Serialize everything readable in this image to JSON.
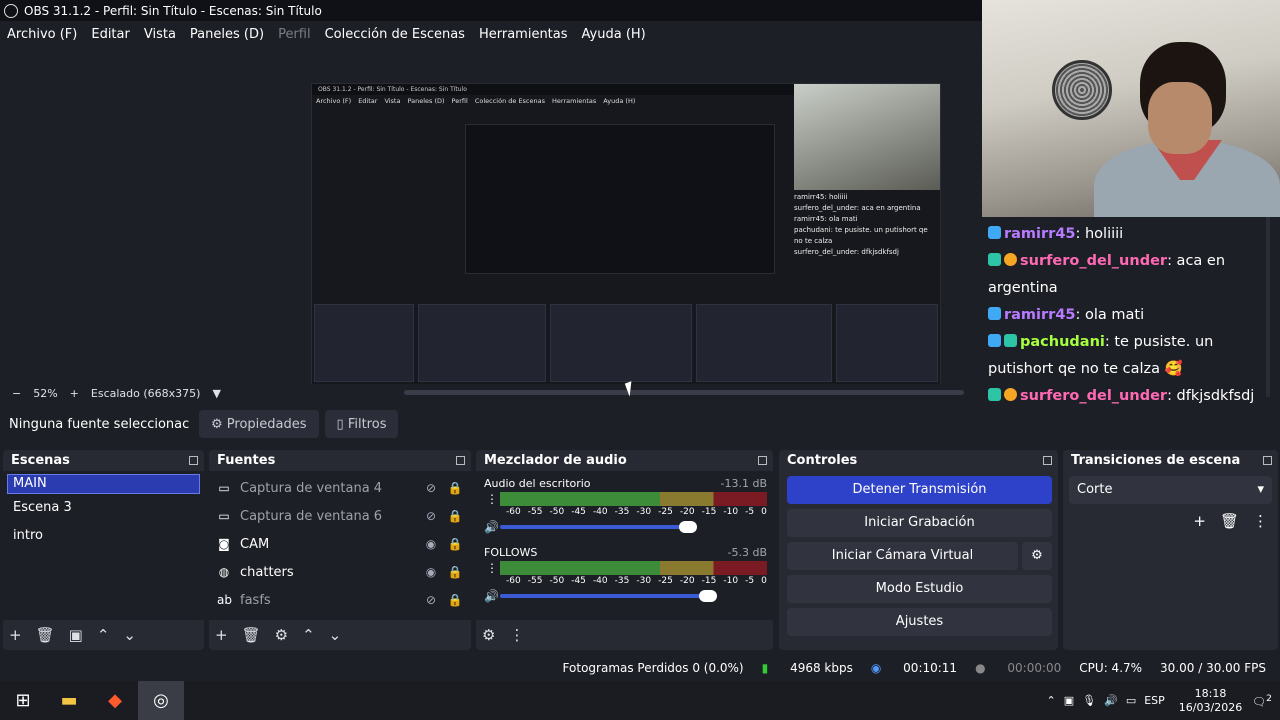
{
  "window": {
    "title": "OBS 31.1.2 - Perfil: Sin Título - Escenas: Sin Título"
  },
  "menu": [
    {
      "label": "Archivo (F)",
      "disabled": false
    },
    {
      "label": "Editar",
      "disabled": false
    },
    {
      "label": "Vista",
      "disabled": false
    },
    {
      "label": "Paneles (D)",
      "disabled": false
    },
    {
      "label": "Perfil",
      "disabled": true
    },
    {
      "label": "Colección de Escenas",
      "disabled": false
    },
    {
      "label": "Herramientas",
      "disabled": false
    },
    {
      "label": "Ayuda (H)",
      "disabled": false
    }
  ],
  "nested_preview": {
    "title": "OBS 31.1.2 - Perfil: Sin Título - Escenas: Sin Título",
    "menu": [
      "Archivo (F)",
      "Editar",
      "Vista",
      "Paneles (D)",
      "Perfil",
      "Colección de Escenas",
      "Herramientas",
      "Ayuda (H)"
    ],
    "chat": [
      "ramirr45: holiiii",
      "surfero_del_under: aca en argentina",
      "ramirr45: ola mati",
      "pachudani: te pusiste. un putishort qe no te calza",
      "surfero_del_under: dfkjsdkfsdj"
    ]
  },
  "chat": {
    "messages": [
      {
        "user": "ramirr45",
        "text": ": holiiii",
        "color": "#b77bff"
      },
      {
        "user": "surfero_del_under",
        "text": ": aca en argentina",
        "color": "#ff69b4"
      },
      {
        "user": "ramirr45",
        "text": ": ola mati",
        "color": "#b77bff"
      },
      {
        "user": "pachudani",
        "text": ": te pusiste. un putishort qe no te calza 🥰",
        "color": "#a6ff3f"
      },
      {
        "user": "surfero_del_under",
        "text": ": dfkjsdkfsdj",
        "color": "#ff69b4"
      }
    ]
  },
  "scale": {
    "minus": "−",
    "zoom": "52%",
    "plus": "+",
    "label": "Escalado (668x375)"
  },
  "propbar": {
    "no_source": "Ninguna fuente seleccionac",
    "properties": "Propiedades",
    "filters": "Filtros"
  },
  "scenes": {
    "title": "Escenas",
    "items": [
      "MAIN",
      "Escena 3",
      "intro"
    ],
    "selected": 0
  },
  "sources": {
    "title": "Fuentes",
    "items": [
      {
        "name": "Captura de ventana 4",
        "icon": "window-icon",
        "visible": false
      },
      {
        "name": "Captura de ventana 6",
        "icon": "window-icon",
        "visible": false
      },
      {
        "name": "CAM",
        "icon": "camera-icon",
        "visible": true
      },
      {
        "name": "chatters",
        "icon": "browser-icon",
        "visible": true
      },
      {
        "name": "fasfs",
        "icon": "text-icon",
        "visible": false
      }
    ]
  },
  "mixer": {
    "title": "Mezclador de audio",
    "channels": [
      {
        "name": "Audio del escritorio",
        "db": "-13.1 dB",
        "volume": 0.78
      },
      {
        "name": "FOLLOWS",
        "db": "-5.3 dB",
        "volume": 0.9
      }
    ],
    "ticks": [
      "-60",
      "-55",
      "-50",
      "-45",
      "-40",
      "-35",
      "-30",
      "-25",
      "-20",
      "-15",
      "-10",
      "-5",
      "0"
    ]
  },
  "controls": {
    "title": "Controles",
    "stop_stream": "Detener Transmisión",
    "start_record": "Iniciar Grabación",
    "virtual_cam": "Iniciar Cámara Virtual",
    "studio": "Modo Estudio",
    "settings": "Ajustes"
  },
  "transitions": {
    "title": "Transiciones de escena",
    "selected": "Corte"
  },
  "status": {
    "dropped": "Fotogramas Perdidos 0 (0.0%)",
    "bitrate": "4968 kbps",
    "stream_time": "00:10:11",
    "rec_time": "00:00:00",
    "cpu": "CPU: 4.7%",
    "fps": "30.00 / 30.00 FPS"
  },
  "taskbar": {
    "lang": "ESP",
    "time": "18:18",
    "date": "16/03/2026",
    "notif": "2"
  }
}
